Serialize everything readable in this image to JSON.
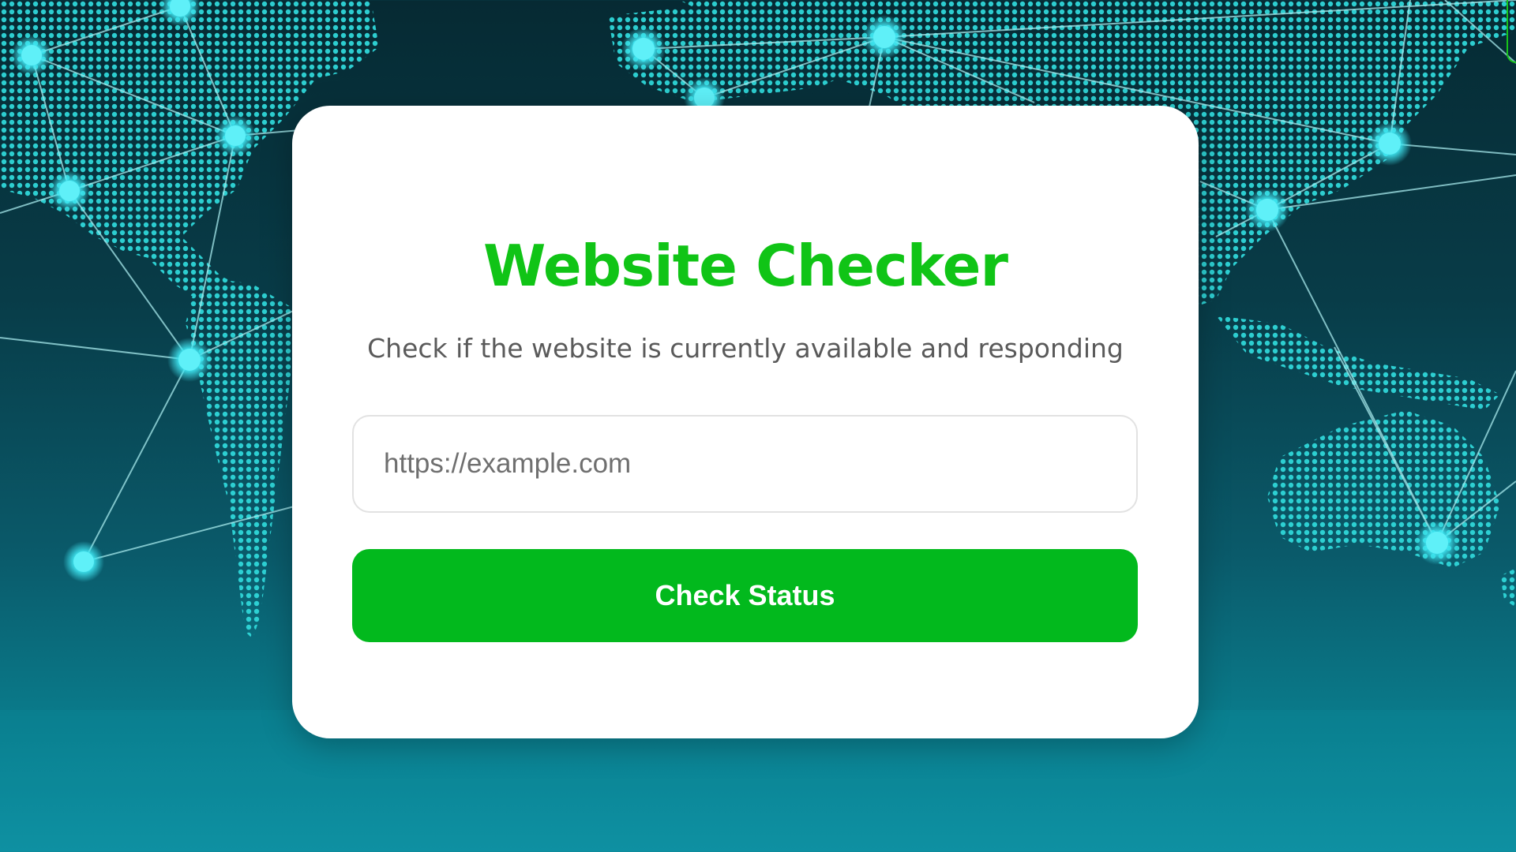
{
  "app": {
    "title": "Website Checker",
    "subtitle": "Check if the website is currently available and responding"
  },
  "form": {
    "url_input": {
      "value": "",
      "placeholder": "https://example.com"
    },
    "submit_label": "Check Status"
  },
  "colors": {
    "brand_green": "#10c416",
    "button_green": "#02b91d",
    "node_cyan": "#3fe6f2",
    "background_dark": "#062a33"
  },
  "icons": {
    "background": "world-map-network-icon"
  }
}
